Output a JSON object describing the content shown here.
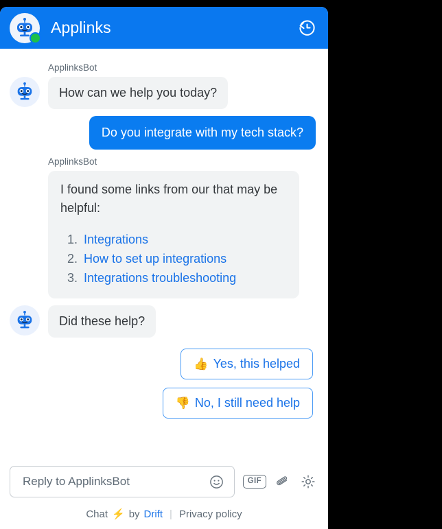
{
  "header": {
    "title": "Applinks",
    "avatar_icon": "robot-avatar-icon",
    "status_dot": "online-status-dot",
    "history_icon": "history-restore-icon",
    "background_color": "#0a78ef"
  },
  "conversation": [
    {
      "type": "bot-label",
      "sender": "ApplinksBot"
    },
    {
      "type": "bot-message",
      "text": "How can we help you today?"
    },
    {
      "type": "user-message",
      "text": "Do you integrate with my tech stack?"
    },
    {
      "type": "bot-label",
      "sender": "ApplinksBot"
    },
    {
      "type": "bot-links-message",
      "text": "I found some links from our that may be helpful:",
      "links": [
        "Integrations",
        "How to set up integrations",
        "Integrations troubleshooting"
      ]
    },
    {
      "type": "bot-message",
      "text": "Did these help?"
    }
  ],
  "messages": {
    "sender_name": "ApplinksBot",
    "greeting": "How can we help you today?",
    "user_question": "Do you integrate with my tech stack?",
    "links_intro": "I found some links from our that may be helpful:",
    "link_1": "Integrations",
    "link_2": "How to set up integrations",
    "link_3": "Integrations troubleshooting",
    "followup": "Did these help?"
  },
  "quick_replies": [
    {
      "emoji": "👍",
      "label": "Yes, this helped"
    },
    {
      "emoji": "👎",
      "label": "No, I still need help"
    }
  ],
  "quick_reply_labels": {
    "yes": "Yes, this helped",
    "yes_emoji": "👍",
    "no": "No, I still need help",
    "no_emoji": "👎"
  },
  "composer": {
    "placeholder": "Reply to ApplinksBot",
    "value": "",
    "emoji_icon": "smiley-face-icon",
    "gif_label": "GIF",
    "attachment_icon": "paperclip-icon",
    "settings_icon": "gear-icon"
  },
  "footer": {
    "chat_text": "Chat",
    "bolt": "⚡",
    "by_text": "by",
    "brand": "Drift",
    "divider": "|",
    "privacy": "Privacy policy"
  },
  "colors": {
    "brand_blue": "#0a78ef",
    "user_bubble": "#0a7cf0",
    "bot_bubble": "#f1f3f4",
    "link_blue": "#1a73e8",
    "status_green": "#1ec04a",
    "text_grey": "#5f6b76"
  }
}
